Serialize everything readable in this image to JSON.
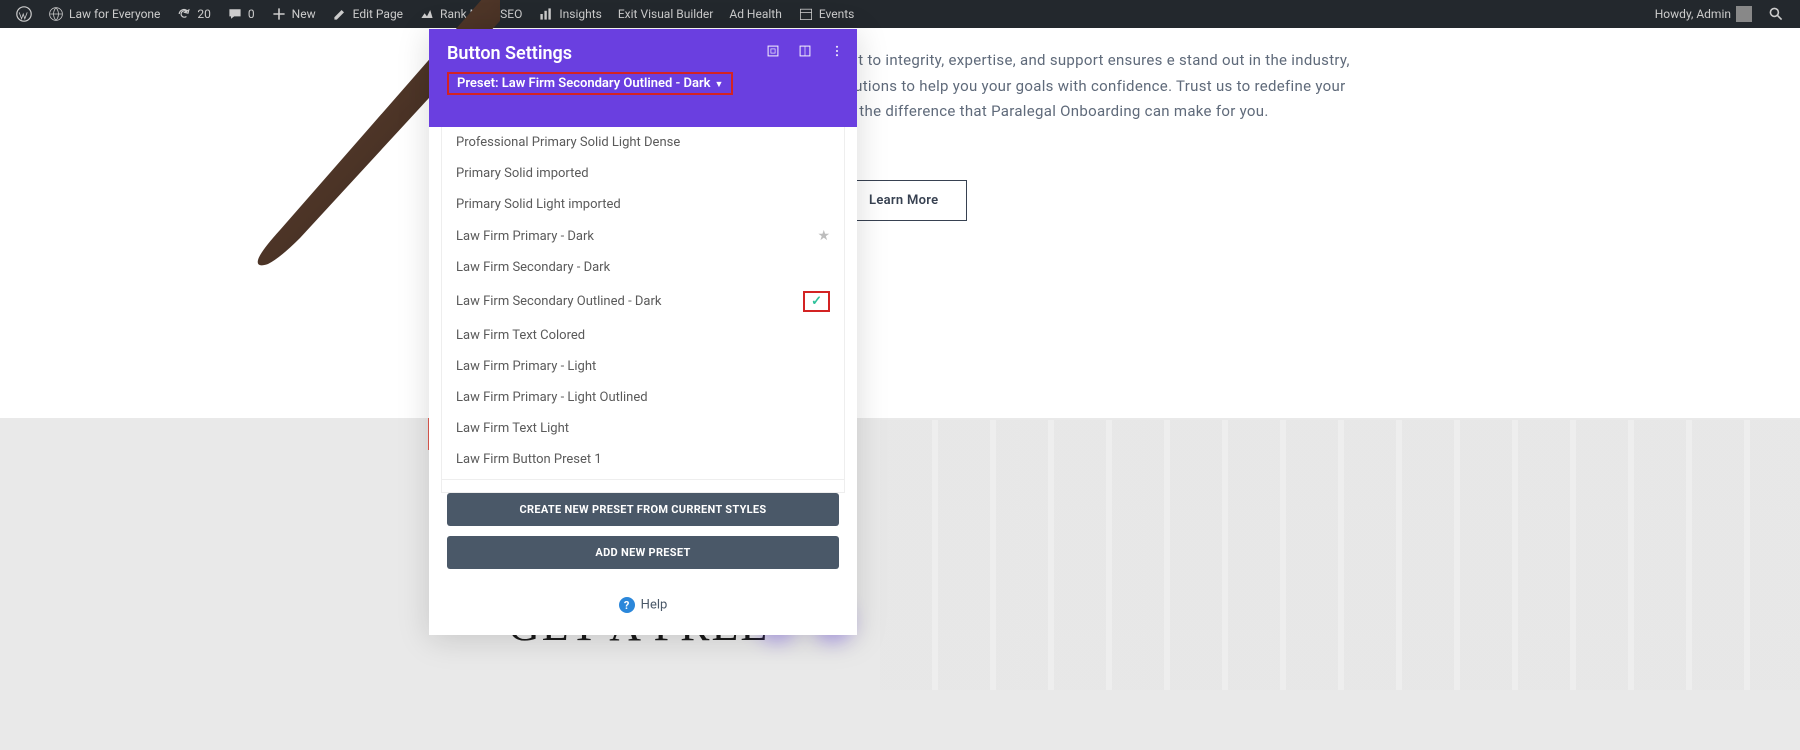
{
  "adminbar": {
    "site": "Law for Everyone",
    "updates": "20",
    "comments": "0",
    "new": "New",
    "edit_page": "Edit Page",
    "rank_math": "Rank Math SEO",
    "insights": "Insights",
    "exit_vb": "Exit Visual Builder",
    "ad_health": "Ad Health",
    "events": "Events",
    "howdy": "Howdy, Admin"
  },
  "page": {
    "body_text": "nwavering commitment to integrity, expertise, and support ensures e stand out in the industry, offering innovative solutions to help you your goals with confidence. Trust us to redefine your legal journey and ence the difference that Paralegal Onboarding can make for you.",
    "learn_more": "Learn More",
    "headline": "GET A FREE"
  },
  "modal": {
    "title": "Button Settings",
    "preset_label": "Preset: Law Firm Secondary Outlined - Dark",
    "items": [
      {
        "label": "Professional Primary Solid Light Dense"
      },
      {
        "label": "Primary Solid imported"
      },
      {
        "label": "Primary Solid Light imported"
      },
      {
        "label": "Law Firm Primary - Dark",
        "starred": true
      },
      {
        "label": "Law Firm Secondary - Dark"
      },
      {
        "label": "Law Firm Secondary Outlined - Dark",
        "selected": true
      },
      {
        "label": "Law Firm Text Colored"
      },
      {
        "label": "Law Firm Primary - Light"
      },
      {
        "label": "Law Firm Primary - Light Outlined"
      },
      {
        "label": "Law Firm Text Light"
      },
      {
        "label": "Law Firm Button Preset 1"
      }
    ],
    "btn_create": "CREATE NEW PRESET FROM CURRENT STYLES",
    "btn_add": "ADD NEW PRESET",
    "help": "Help"
  }
}
